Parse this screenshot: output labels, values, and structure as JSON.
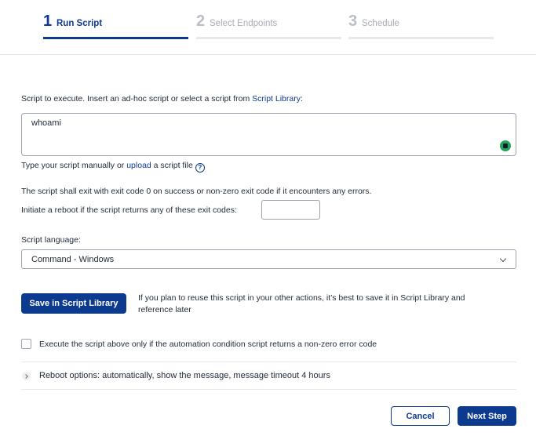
{
  "steps": [
    {
      "number": "1",
      "label": "Run Script"
    },
    {
      "number": "2",
      "label": "Select Endpoints"
    },
    {
      "number": "3",
      "label": "Schedule"
    }
  ],
  "script": {
    "prompt": "Script to execute. Insert an ad-hoc script or select a script from ",
    "library_link": "Script Library",
    "prompt_suffix": ":",
    "value": "whoami",
    "hint_prefix": "Type your script manually or ",
    "upload_link": "upload",
    "hint_suffix": " a script file",
    "help_glyph": "?"
  },
  "exit_codes": {
    "info": "The script shall exit with exit code 0 on success or non-zero exit code if it encounters any errors.",
    "label": "Initiate a reboot if the script returns any of these exit codes:",
    "value": ""
  },
  "language": {
    "label": "Script language:",
    "selected": "Command - Windows"
  },
  "save": {
    "button": "Save in Script Library",
    "note_line1": "If you plan to reuse this script in your other actions, it’s best to save it in Script Library and",
    "note_line2": "reference later"
  },
  "condition": {
    "label": "Execute the script above only if the automation condition script returns a non-zero error code",
    "checked": false
  },
  "reboot": {
    "label": "Reboot options: automatically, show the message, message timeout 4 hours"
  },
  "footer": {
    "cancel": "Cancel",
    "next": "Next Step"
  },
  "colors": {
    "primary": "#0b3a8e",
    "border": "#9ca3af",
    "ai_badge": "#22a55b"
  }
}
